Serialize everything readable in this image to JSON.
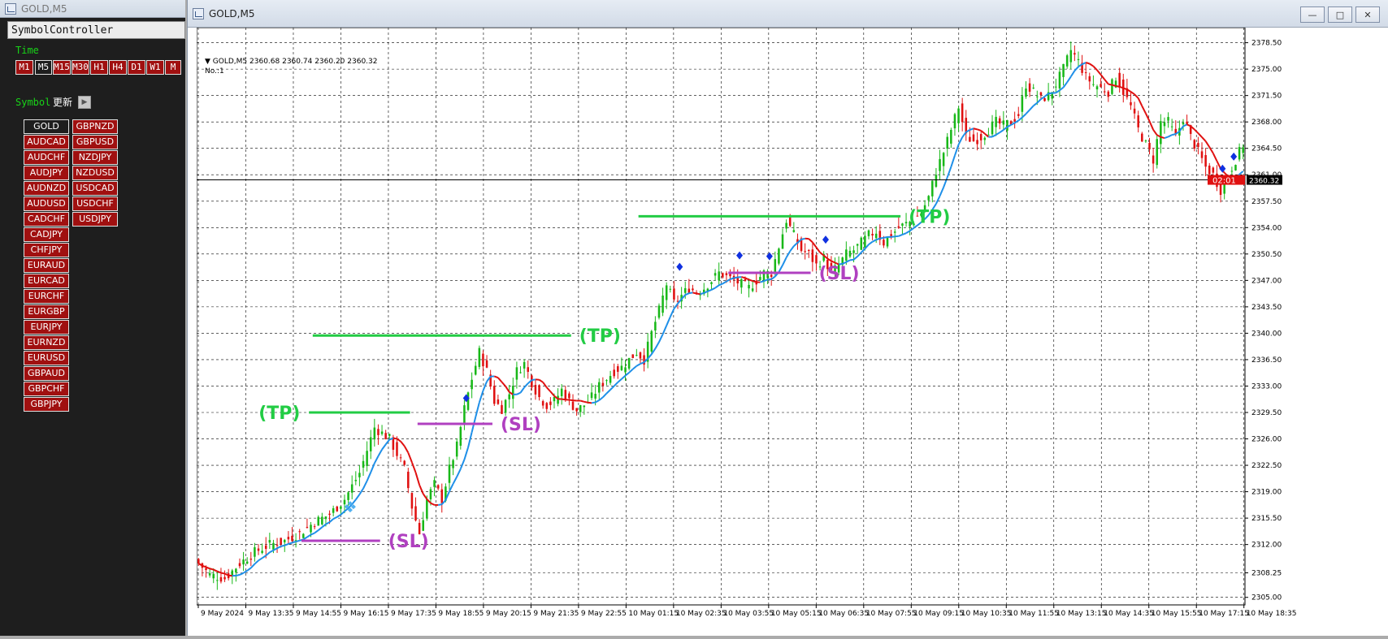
{
  "left_window": {
    "title": "GOLD,M5",
    "panel_title": "SymbolController",
    "time_label": "Time",
    "timeframes": [
      {
        "label": "M1",
        "active": false
      },
      {
        "label": "M5",
        "active": true
      },
      {
        "label": "M15",
        "active": false
      },
      {
        "label": "M30",
        "active": false
      },
      {
        "label": "H1",
        "active": false
      },
      {
        "label": "H4",
        "active": false
      },
      {
        "label": "D1",
        "active": false
      },
      {
        "label": "W1",
        "active": false
      },
      {
        "label": "M",
        "active": false
      }
    ],
    "symbol_label": "Symbol",
    "refresh_label": "更新",
    "symbols_col1": [
      "GOLD",
      "AUDCAD",
      "AUDCHF",
      "AUDJPY",
      "AUDNZD",
      "AUDUSD",
      "CADCHF",
      "CADJPY",
      "CHFJPY",
      "EURAUD",
      "EURCAD",
      "EURCHF",
      "EURGBP",
      "EURJPY",
      "EURNZD",
      "EURUSD",
      "GBPAUD",
      "GBPCHF",
      "GBPJPY"
    ],
    "symbols_col2": [
      "GBPNZD",
      "GBPUSD",
      "NZDJPY",
      "NZDUSD",
      "USDCAD",
      "USDCHF",
      "USDJPY"
    ],
    "active_symbol": "GOLD"
  },
  "main_window": {
    "title": "GOLD,M5"
  },
  "chart_header": {
    "symbol_tf": "GOLD,M5",
    "ohlc": "2360.68 2360.74 2360.20 2360.32",
    "sub": "No.:1"
  },
  "colors": {
    "up": "#18b818",
    "down": "#e01010",
    "ma_up": "#1e8fe8",
    "ma_down": "#e01010",
    "tp": "#22cc44",
    "sl": "#b040c0",
    "price_tag": "#e01010",
    "marker": "#1030e0"
  },
  "price_tag": {
    "time_left": "02:01",
    "price": "2360.32"
  },
  "chart_data": {
    "type": "candlestick",
    "y_ticks": [
      2305.0,
      2308.25,
      2312.0,
      2315.5,
      2319.0,
      2322.5,
      2326.0,
      2329.5,
      2333.0,
      2336.5,
      2340.0,
      2343.5,
      2347.0,
      2350.5,
      2354.0,
      2357.5,
      2361.0,
      2364.5,
      2368.0,
      2371.5,
      2375.0,
      2378.5
    ],
    "y_tick_labels": [
      "2305.00",
      "2308.25",
      "2312.00",
      "2315.50",
      "2319.00",
      "2322.50",
      "2326.00",
      "2329.50",
      "2333.00",
      "2336.50",
      "2340.00",
      "2343.50",
      "2347.00",
      "2350.50",
      "2354.00",
      "2357.50",
      "2361.00",
      "2364.50",
      "2368.00",
      "2371.50",
      "2375.00",
      "2378.50"
    ],
    "ylim": [
      2304.0,
      2380.5
    ],
    "x_labels": [
      "9 May 2024",
      "9 May 13:35",
      "9 May 14:55",
      "9 May 16:15",
      "9 May 17:35",
      "9 May 18:55",
      "9 May 20:15",
      "9 May 21:35",
      "9 May 22:55",
      "10 May 01:15",
      "10 May 02:35",
      "10 May 03:55",
      "10 May 05:15",
      "10 May 06:35",
      "10 May 07:55",
      "10 May 09:15",
      "10 May 10:35",
      "10 May 11:55",
      "10 May 13:15",
      "10 May 14:35",
      "10 May 15:55",
      "10 May 17:15",
      "10 May 18:35"
    ],
    "close_path": [
      [
        0,
        2310
      ],
      [
        4,
        2308
      ],
      [
        8,
        2307.5
      ],
      [
        12,
        2309.5
      ],
      [
        16,
        2311
      ],
      [
        20,
        2312
      ],
      [
        24,
        2312.5
      ],
      [
        28,
        2313.5
      ],
      [
        32,
        2315
      ],
      [
        36,
        2316
      ],
      [
        40,
        2318
      ],
      [
        44,
        2321.5
      ],
      [
        48,
        2327.5
      ],
      [
        52,
        2326
      ],
      [
        56,
        2322
      ],
      [
        58,
        2317
      ],
      [
        60,
        2313.5
      ],
      [
        62,
        2318
      ],
      [
        64,
        2320
      ],
      [
        66,
        2318
      ],
      [
        68,
        2322
      ],
      [
        70,
        2325
      ],
      [
        72,
        2330
      ],
      [
        74,
        2334
      ],
      [
        76,
        2337.5
      ],
      [
        78,
        2335
      ],
      [
        80,
        2331
      ],
      [
        82,
        2330
      ],
      [
        84,
        2332
      ],
      [
        86,
        2335
      ],
      [
        88,
        2336
      ],
      [
        90,
        2333.5
      ],
      [
        92,
        2331.5
      ],
      [
        94,
        2330.5
      ],
      [
        96,
        2331
      ],
      [
        98,
        2332.5
      ],
      [
        100,
        2331
      ],
      [
        102,
        2329.8
      ],
      [
        104,
        2330.5
      ],
      [
        106,
        2331.5
      ],
      [
        108,
        2333
      ],
      [
        110,
        2334
      ],
      [
        112,
        2335
      ],
      [
        114,
        2335.5
      ],
      [
        116,
        2336.5
      ],
      [
        118,
        2337.5
      ],
      [
        120,
        2336.5
      ],
      [
        122,
        2340
      ],
      [
        124,
        2343
      ],
      [
        126,
        2346.5
      ],
      [
        128,
        2344
      ],
      [
        130,
        2345
      ],
      [
        132,
        2346
      ],
      [
        134,
        2345.5
      ],
      [
        136,
        2346
      ],
      [
        138,
        2347
      ],
      [
        140,
        2348
      ],
      [
        142,
        2347.5
      ],
      [
        144,
        2347
      ],
      [
        146,
        2346.5
      ],
      [
        148,
        2346
      ],
      [
        150,
        2347
      ],
      [
        152,
        2348
      ],
      [
        154,
        2348
      ],
      [
        156,
        2351.5
      ],
      [
        158,
        2355
      ],
      [
        160,
        2353
      ],
      [
        162,
        2351
      ],
      [
        164,
        2350.5
      ],
      [
        166,
        2349
      ],
      [
        168,
        2350
      ],
      [
        170,
        2348
      ],
      [
        172,
        2349
      ],
      [
        174,
        2350.5
      ],
      [
        176,
        2351
      ],
      [
        178,
        2352
      ],
      [
        180,
        2353
      ],
      [
        182,
        2353.5
      ],
      [
        184,
        2352
      ],
      [
        186,
        2353
      ],
      [
        188,
        2354
      ],
      [
        190,
        2354.5
      ],
      [
        192,
        2355
      ],
      [
        194,
        2356
      ],
      [
        196,
        2358
      ],
      [
        198,
        2361.5
      ],
      [
        200,
        2364
      ],
      [
        202,
        2367
      ],
      [
        204,
        2370
      ],
      [
        206,
        2366
      ],
      [
        208,
        2365.5
      ],
      [
        210,
        2366
      ],
      [
        212,
        2367
      ],
      [
        214,
        2368
      ],
      [
        216,
        2367.5
      ],
      [
        218,
        2368
      ],
      [
        220,
        2369
      ],
      [
        222,
        2373
      ],
      [
        224,
        2372
      ],
      [
        226,
        2371
      ],
      [
        228,
        2371.5
      ],
      [
        230,
        2373
      ],
      [
        232,
        2375
      ],
      [
        234,
        2377.5
      ],
      [
        236,
        2376
      ],
      [
        238,
        2374
      ],
      [
        240,
        2373
      ],
      [
        242,
        2372.5
      ],
      [
        244,
        2372
      ],
      [
        246,
        2374
      ],
      [
        248,
        2372
      ],
      [
        250,
        2370
      ],
      [
        252,
        2367
      ],
      [
        254,
        2365
      ],
      [
        256,
        2363
      ],
      [
        258,
        2368
      ],
      [
        260,
        2368
      ],
      [
        262,
        2366
      ],
      [
        264,
        2368.5
      ],
      [
        266,
        2366
      ],
      [
        268,
        2364
      ],
      [
        270,
        2362
      ],
      [
        272,
        2361
      ],
      [
        274,
        2359
      ],
      [
        276,
        2361
      ],
      [
        278,
        2363
      ],
      [
        280,
        2365
      ]
    ],
    "n_bars": 280,
    "ma_period": 8,
    "tp_lines": [
      {
        "x0": 30,
        "x1": 57,
        "y": 2329.5,
        "label": "(TP)",
        "label_side": "left"
      },
      {
        "x0": 31,
        "x1": 100,
        "y": 2339.7,
        "label": "(TP)",
        "label_side": "right"
      },
      {
        "x0": 118,
        "x1": 188,
        "y": 2355.5,
        "label": "(TP)",
        "label_side": "right"
      }
    ],
    "sl_lines": [
      {
        "x0": 28,
        "x1": 49,
        "y": 2312.5,
        "label": "(SL)",
        "label_side": "right"
      },
      {
        "x0": 59,
        "x1": 79,
        "y": 2328.0,
        "label": "(SL)",
        "label_side": "right"
      },
      {
        "x0": 142,
        "x1": 164,
        "y": 2348.0,
        "label": "(SL)",
        "label_side": "right"
      }
    ],
    "markers": [
      [
        72,
        2331.4
      ],
      [
        129,
        2348.8
      ],
      [
        145,
        2350.3
      ],
      [
        153,
        2350.2
      ],
      [
        168,
        2352.4
      ],
      [
        274,
        2361.8
      ],
      [
        277,
        2363.4
      ]
    ],
    "arrow_marker": [
      41,
      2317.0
    ],
    "current_price": 2360.32
  }
}
